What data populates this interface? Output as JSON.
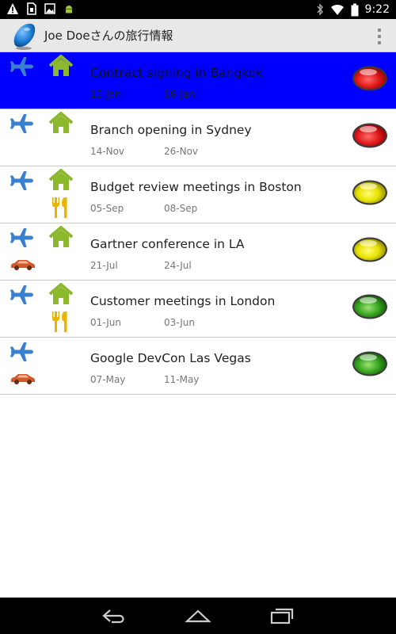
{
  "status_bar": {
    "time": "9:22",
    "left_icons": [
      "warning-icon",
      "sim-icon",
      "image-icon",
      "android-icon"
    ],
    "right_icons": [
      "bluetooth-icon",
      "wifi-icon",
      "battery-icon"
    ]
  },
  "app": {
    "title": "Joe Doeさんの旅行情報",
    "icon": "blue-drop-icon",
    "menu_icon": "overflow-menu-icon"
  },
  "colors": {
    "selected_row": "#0000ff",
    "red": "#e21c1c",
    "yellow": "#e8e300",
    "green": "#3aa61f",
    "plane": "#3a7fd0",
    "home": "#8cb82e",
    "fork": "#e8b400",
    "car": "#d05a2a"
  },
  "trips": [
    {
      "title": "Contract signing in Bangkok",
      "start": "15-Jan",
      "end": "16-Jan",
      "status": "red",
      "icons": [
        "plane",
        "home"
      ],
      "selected": true
    },
    {
      "title": "Branch opening in Sydney",
      "start": "14-Nov",
      "end": "26-Nov",
      "status": "red",
      "icons": [
        "plane",
        "home"
      ],
      "selected": false
    },
    {
      "title": "Budget review meetings in Boston",
      "start": "05-Sep",
      "end": "08-Sep",
      "status": "yellow",
      "icons": [
        "plane",
        "home",
        "fork"
      ],
      "selected": false
    },
    {
      "title": "Gartner conference in LA",
      "start": "21-Jul",
      "end": "24-Jul",
      "status": "yellow",
      "icons": [
        "plane",
        "home",
        "car"
      ],
      "selected": false
    },
    {
      "title": "Customer meetings in London",
      "start": "01-Jun",
      "end": "03-Jun",
      "status": "green",
      "icons": [
        "plane",
        "home",
        "fork"
      ],
      "selected": false
    },
    {
      "title": "Google DevCon Las Vegas",
      "start": "07-May",
      "end": "11-May",
      "status": "green",
      "icons": [
        "plane",
        "car"
      ],
      "selected": false
    }
  ],
  "nav_bar": {
    "icons": [
      "back-icon",
      "home-icon",
      "recent-apps-icon"
    ]
  }
}
